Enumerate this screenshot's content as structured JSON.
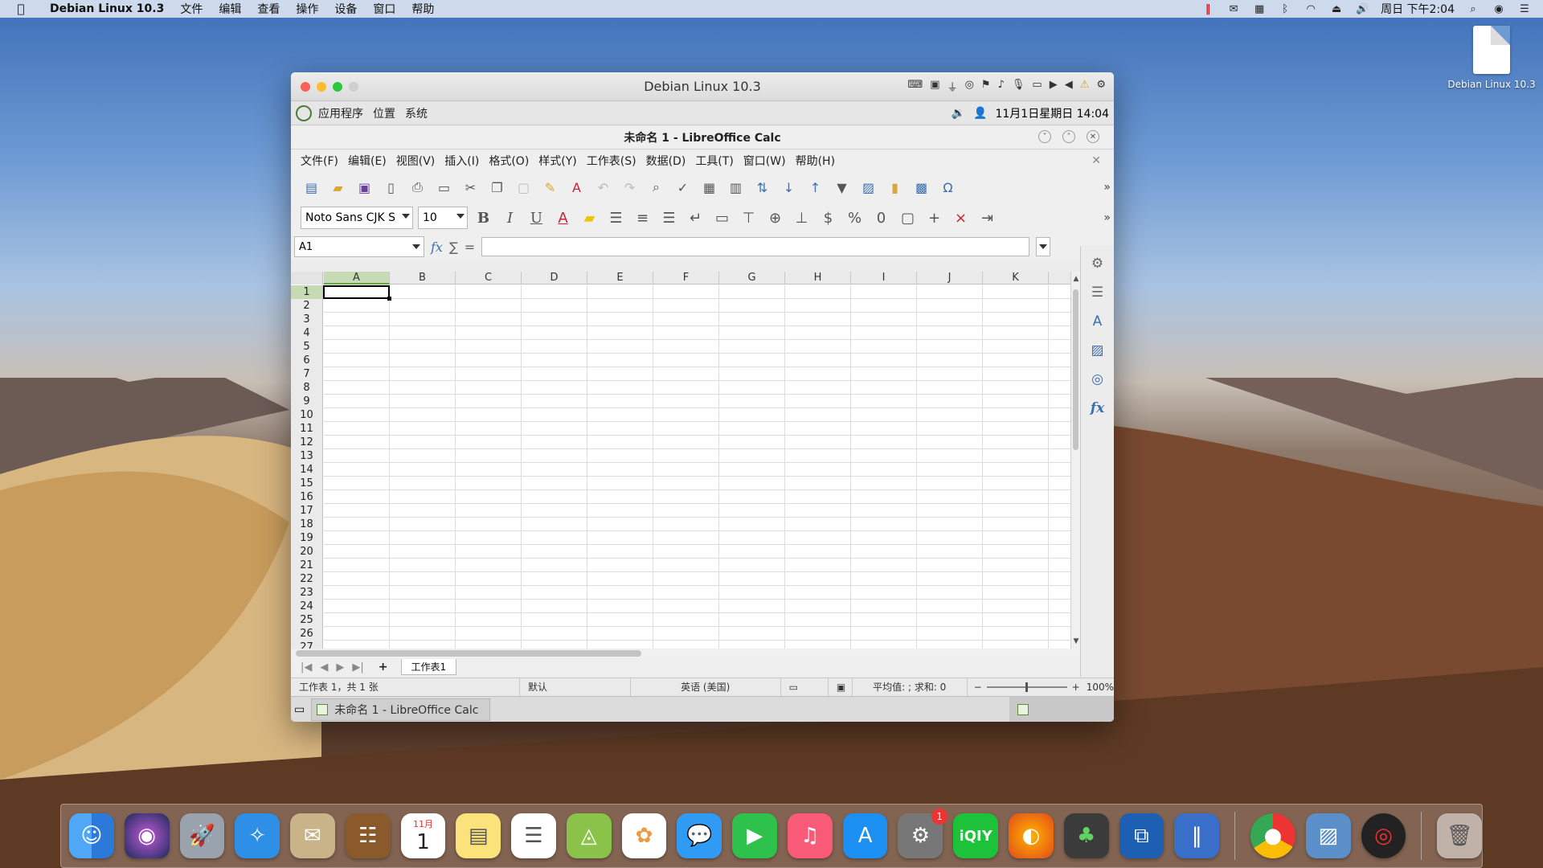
{
  "menubar": {
    "app_name": "Debian Linux 10.3",
    "items": [
      "文件",
      "编辑",
      "查看",
      "操作",
      "设备",
      "窗口",
      "帮助"
    ],
    "clock": "周日 下午2:04"
  },
  "desktop": {
    "file_label": "Debian Linux 10.3"
  },
  "vm_window": {
    "title": "Debian Linux 10.3"
  },
  "gnome_panel": {
    "items": [
      "应用程序",
      "位置",
      "系统"
    ],
    "datetime": "11月1日星期日 14:04"
  },
  "calc": {
    "title": "未命名 1 - LibreOffice Calc",
    "menu": [
      "文件(F)",
      "编辑(E)",
      "视图(V)",
      "插入(I)",
      "格式(O)",
      "样式(Y)",
      "工作表(S)",
      "数据(D)",
      "工具(T)",
      "窗口(W)",
      "帮助(H)"
    ],
    "font_name": "Noto Sans CJK S",
    "font_size": "10",
    "name_box": "A1",
    "columns": [
      "A",
      "B",
      "C",
      "D",
      "E",
      "F",
      "G",
      "H",
      "I",
      "J",
      "K"
    ],
    "rows": [
      "1",
      "2",
      "3",
      "4",
      "5",
      "6",
      "7",
      "8",
      "9",
      "10",
      "11",
      "12",
      "13",
      "14",
      "15",
      "16",
      "17",
      "18",
      "19",
      "20",
      "21",
      "22",
      "23",
      "24",
      "25",
      "26",
      "27"
    ],
    "sheet_tab": "工作表1",
    "status": {
      "sheet_info": "工作表 1，共 1 张",
      "page_style": "默认",
      "language": "英语 (美国)",
      "summary": "平均值: ; 求和: 0",
      "zoom": "100%"
    },
    "taskbar_item": "未命名 1 - LibreOffice Calc"
  },
  "dock": {
    "calendar_month": "11月",
    "calendar_day": "1",
    "badge_count": "1",
    "iqiyi_text": "iQIY"
  }
}
